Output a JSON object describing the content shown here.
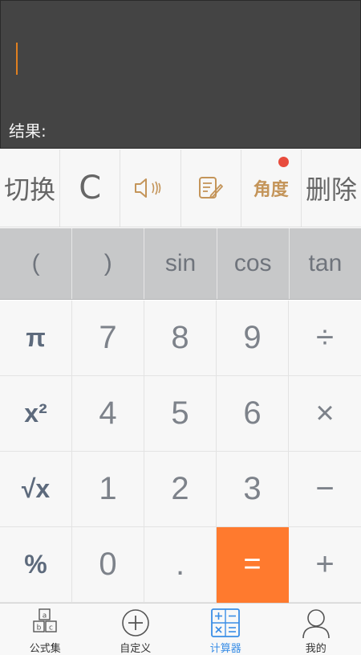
{
  "display": {
    "expression": "",
    "result_label": "结果:"
  },
  "function_row": {
    "switch_label": "切换",
    "clear_label": "C",
    "sound_icon": "speaker-icon",
    "history_icon": "edit-note-icon",
    "angle_label": "角度",
    "delete_label": "删除"
  },
  "scientific_row": [
    "(",
    ")",
    "sin",
    "cos",
    "tan"
  ],
  "keypad": [
    [
      "π",
      "7",
      "8",
      "9",
      "÷"
    ],
    [
      "x²",
      "4",
      "5",
      "6",
      "×"
    ],
    [
      "√x",
      "1",
      "2",
      "3",
      "−"
    ],
    [
      "%",
      "0",
      ".",
      "=",
      "+"
    ]
  ],
  "tabs": [
    {
      "label": "公式集",
      "icon": "abc-blocks-icon"
    },
    {
      "label": "自定义",
      "icon": "plus-circle-icon"
    },
    {
      "label": "计算器",
      "icon": "calculator-icon",
      "active": true
    },
    {
      "label": "我的",
      "icon": "user-icon"
    }
  ],
  "colors": {
    "accent": "#ff7a2e",
    "active_tab": "#3a8ee6",
    "angle": "#c4955a",
    "dot": "#e84c3d"
  }
}
